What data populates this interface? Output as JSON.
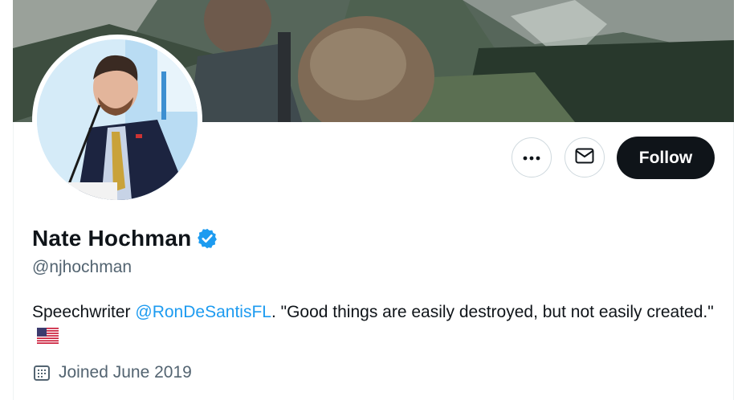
{
  "profile": {
    "display_name": "Nate Hochman",
    "handle": "@njhochman",
    "bio_prefix": "Speechwriter ",
    "bio_mention": "@RonDeSantisFL",
    "bio_suffix": ". \"Good things are easily destroyed, but not easily created.\"",
    "joined": "Joined June 2019"
  },
  "actions": {
    "more_icon": "more-horizontal-icon",
    "message_icon": "envelope-icon",
    "follow_label": "Follow"
  },
  "colors": {
    "accent": "#1d9bf0",
    "follow_bg": "#0f1419",
    "secondary_text": "#536471"
  }
}
